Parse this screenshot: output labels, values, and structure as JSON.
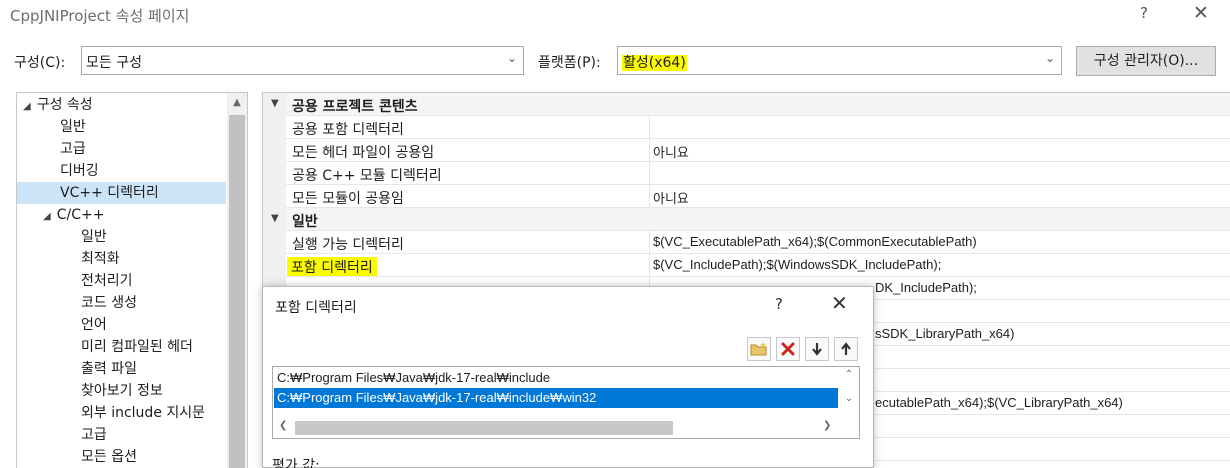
{
  "window": {
    "title": "CppJNIProject 속성 페이지",
    "help": "?",
    "close": "✕"
  },
  "toolbar": {
    "config_label": "구성(C):",
    "config_value": "모든 구성",
    "platform_label": "플랫폼(P):",
    "platform_value": "활성(x64)",
    "config_manager_label": "구성 관리자(O)...",
    "dropdown_icon": "chevron-down-icon"
  },
  "tree": {
    "items": [
      {
        "label": "구성 속성",
        "indent": 0,
        "expanded": true
      },
      {
        "label": "일반",
        "indent": 1
      },
      {
        "label": "고급",
        "indent": 1
      },
      {
        "label": "디버깅",
        "indent": 1
      },
      {
        "label": "VC++ 디렉터리",
        "indent": 1,
        "selected": true
      },
      {
        "label": "C/C++",
        "indent": 1,
        "expanded": true
      },
      {
        "label": "일반",
        "indent": 2
      },
      {
        "label": "최적화",
        "indent": 2
      },
      {
        "label": "전처리기",
        "indent": 2
      },
      {
        "label": "코드 생성",
        "indent": 2
      },
      {
        "label": "언어",
        "indent": 2
      },
      {
        "label": "미리 컴파일된 헤더",
        "indent": 2
      },
      {
        "label": "출력 파일",
        "indent": 2
      },
      {
        "label": "찾아보기 정보",
        "indent": 2
      },
      {
        "label": "외부 include 지시문",
        "indent": 2
      },
      {
        "label": "고급",
        "indent": 2
      },
      {
        "label": "모든 옵션",
        "indent": 2
      }
    ]
  },
  "grid": {
    "rows": [
      {
        "type": "category",
        "name": "공용 프로젝트 콘텐츠",
        "value": ""
      },
      {
        "type": "prop",
        "name": "공용 포함 디렉터리",
        "value": ""
      },
      {
        "type": "prop",
        "name": "모든 헤더 파일이 공용임",
        "value": "아니요"
      },
      {
        "type": "prop",
        "name": "공용 C++ 모듈 디렉터리",
        "value": ""
      },
      {
        "type": "prop",
        "name": "모든 모듈이 공용임",
        "value": "아니요"
      },
      {
        "type": "category",
        "name": "일반",
        "value": ""
      },
      {
        "type": "prop",
        "name": "실행 가능 디렉터리",
        "value": "$(VC_ExecutablePath_x64);$(CommonExecutablePath)"
      },
      {
        "type": "prop",
        "name": "포함 디렉터리",
        "value": "$(VC_IncludePath);$(WindowsSDK_IncludePath);",
        "highlight": true
      },
      {
        "type": "prop",
        "name": "",
        "value": ""
      },
      {
        "type": "prop",
        "name": "",
        "value": ""
      },
      {
        "type": "prop",
        "name": "",
        "value": ""
      },
      {
        "type": "prop",
        "name": "",
        "value": ""
      },
      {
        "type": "prop",
        "name": "",
        "value": ""
      },
      {
        "type": "prop",
        "name": "",
        "value": ""
      },
      {
        "type": "prop",
        "name": "",
        "value": ""
      },
      {
        "type": "prop",
        "name": "",
        "value": ""
      }
    ],
    "peek_values": [
      {
        "text": "DK_IncludePath);",
        "row": 8
      },
      {
        "text": "sSDK_LibraryPath_x64)",
        "row": 10
      },
      {
        "text": "ecutablePath_x64);$(VC_LibraryPath_x64)",
        "row": 13
      }
    ]
  },
  "dialog": {
    "title": "포함 디렉터리",
    "help": "?",
    "close": "✕",
    "toolbar_icons": [
      "new-folder-icon",
      "delete-icon",
      "move-down-icon",
      "move-up-icon"
    ],
    "items": [
      {
        "path": "C:₩Program Files₩Java₩jdk-17-real₩include",
        "selected": false
      },
      {
        "path": "C:₩Program Files₩Java₩jdk-17-real₩include₩win32",
        "selected": true
      }
    ],
    "eval_label": "평가 값:"
  }
}
